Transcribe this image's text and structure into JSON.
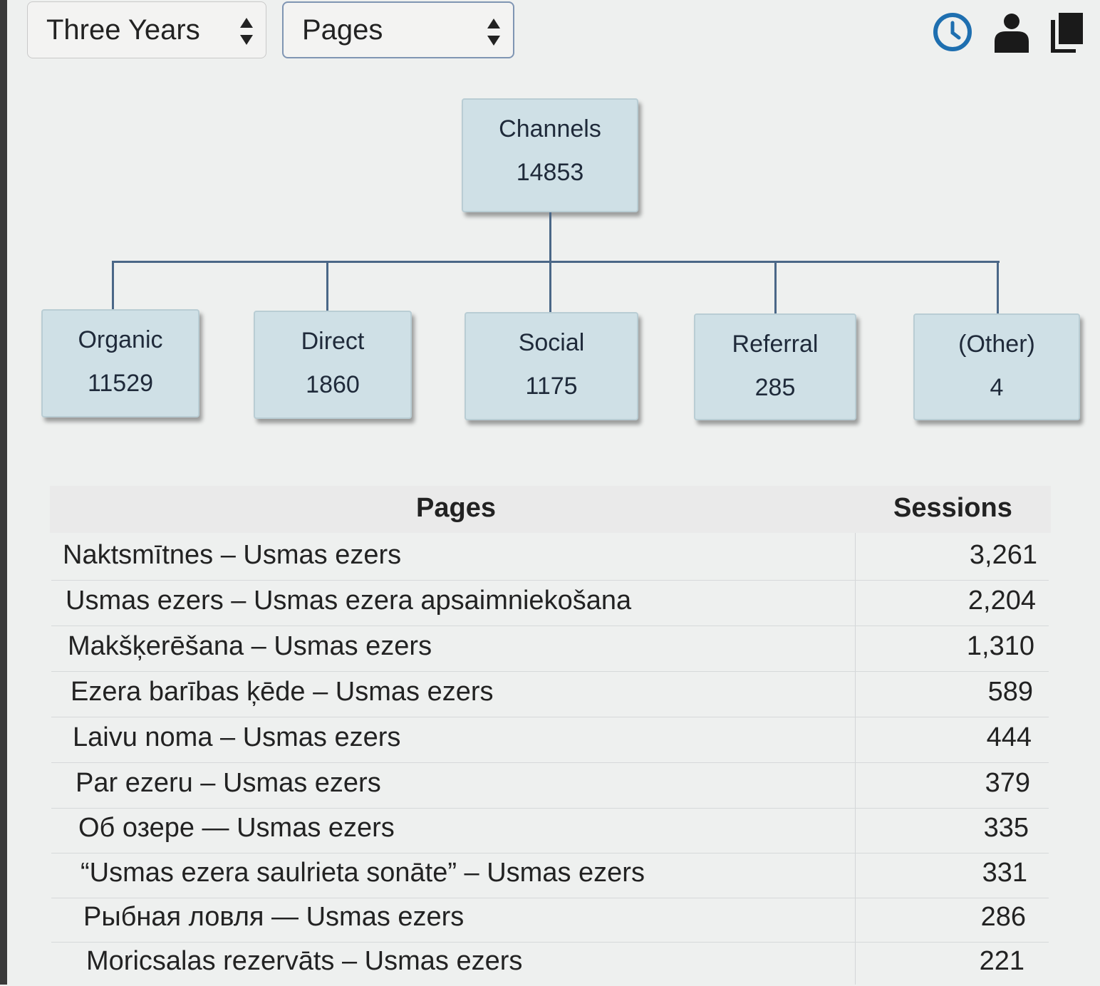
{
  "toolbar": {
    "period_select": "Three Years",
    "dimension_select": "Pages",
    "icons": [
      "clock-icon",
      "user-icon",
      "copy-icon"
    ]
  },
  "tree": {
    "root": {
      "name": "Channels",
      "value": "14853"
    },
    "children": [
      {
        "name": "Organic",
        "value": "11529"
      },
      {
        "name": "Direct",
        "value": "1860"
      },
      {
        "name": "Social",
        "value": "1175"
      },
      {
        "name": "Referral",
        "value": "285"
      },
      {
        "name": "(Other)",
        "value": "4"
      }
    ]
  },
  "table": {
    "headers": {
      "pages": "Pages",
      "sessions": "Sessions"
    },
    "rows": [
      {
        "page": "Naktsmītnes – Usmas ezers",
        "sessions": "3,261"
      },
      {
        "page": "Usmas ezers – Usmas ezera apsaimniekošana",
        "sessions": "2,204"
      },
      {
        "page": "Makšķerēšana – Usmas ezers",
        "sessions": "1,310"
      },
      {
        "page": "Ezera barības ķēde – Usmas ezers",
        "sessions": "589"
      },
      {
        "page": "Laivu noma – Usmas ezers",
        "sessions": "444"
      },
      {
        "page": "Par ezeru – Usmas ezers",
        "sessions": "379"
      },
      {
        "page": "Об озере — Usmas ezers",
        "sessions": "335"
      },
      {
        "page": "“Usmas ezera saulrieta sonāte” – Usmas ezers",
        "sessions": "331"
      },
      {
        "page": "Рыбная ловля — Usmas ezers",
        "sessions": "286"
      },
      {
        "page": "Moricsalas rezervāts – Usmas ezers",
        "sessions": "221"
      }
    ]
  },
  "colors": {
    "accent": "#1e6fb0",
    "node_fill": "#cfe0e6",
    "connector": "#4a6787"
  }
}
